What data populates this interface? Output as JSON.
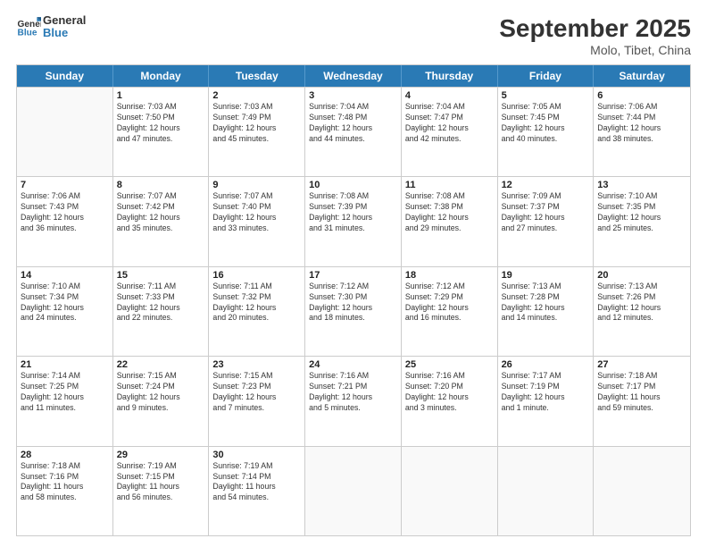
{
  "header": {
    "logo_line1": "General",
    "logo_line2": "Blue",
    "title": "September 2025",
    "subtitle": "Molo, Tibet, China"
  },
  "weekdays": [
    "Sunday",
    "Monday",
    "Tuesday",
    "Wednesday",
    "Thursday",
    "Friday",
    "Saturday"
  ],
  "weeks": [
    [
      {
        "day": "",
        "info": ""
      },
      {
        "day": "1",
        "info": "Sunrise: 7:03 AM\nSunset: 7:50 PM\nDaylight: 12 hours\nand 47 minutes."
      },
      {
        "day": "2",
        "info": "Sunrise: 7:03 AM\nSunset: 7:49 PM\nDaylight: 12 hours\nand 45 minutes."
      },
      {
        "day": "3",
        "info": "Sunrise: 7:04 AM\nSunset: 7:48 PM\nDaylight: 12 hours\nand 44 minutes."
      },
      {
        "day": "4",
        "info": "Sunrise: 7:04 AM\nSunset: 7:47 PM\nDaylight: 12 hours\nand 42 minutes."
      },
      {
        "day": "5",
        "info": "Sunrise: 7:05 AM\nSunset: 7:45 PM\nDaylight: 12 hours\nand 40 minutes."
      },
      {
        "day": "6",
        "info": "Sunrise: 7:06 AM\nSunset: 7:44 PM\nDaylight: 12 hours\nand 38 minutes."
      }
    ],
    [
      {
        "day": "7",
        "info": "Sunrise: 7:06 AM\nSunset: 7:43 PM\nDaylight: 12 hours\nand 36 minutes."
      },
      {
        "day": "8",
        "info": "Sunrise: 7:07 AM\nSunset: 7:42 PM\nDaylight: 12 hours\nand 35 minutes."
      },
      {
        "day": "9",
        "info": "Sunrise: 7:07 AM\nSunset: 7:40 PM\nDaylight: 12 hours\nand 33 minutes."
      },
      {
        "day": "10",
        "info": "Sunrise: 7:08 AM\nSunset: 7:39 PM\nDaylight: 12 hours\nand 31 minutes."
      },
      {
        "day": "11",
        "info": "Sunrise: 7:08 AM\nSunset: 7:38 PM\nDaylight: 12 hours\nand 29 minutes."
      },
      {
        "day": "12",
        "info": "Sunrise: 7:09 AM\nSunset: 7:37 PM\nDaylight: 12 hours\nand 27 minutes."
      },
      {
        "day": "13",
        "info": "Sunrise: 7:10 AM\nSunset: 7:35 PM\nDaylight: 12 hours\nand 25 minutes."
      }
    ],
    [
      {
        "day": "14",
        "info": "Sunrise: 7:10 AM\nSunset: 7:34 PM\nDaylight: 12 hours\nand 24 minutes."
      },
      {
        "day": "15",
        "info": "Sunrise: 7:11 AM\nSunset: 7:33 PM\nDaylight: 12 hours\nand 22 minutes."
      },
      {
        "day": "16",
        "info": "Sunrise: 7:11 AM\nSunset: 7:32 PM\nDaylight: 12 hours\nand 20 minutes."
      },
      {
        "day": "17",
        "info": "Sunrise: 7:12 AM\nSunset: 7:30 PM\nDaylight: 12 hours\nand 18 minutes."
      },
      {
        "day": "18",
        "info": "Sunrise: 7:12 AM\nSunset: 7:29 PM\nDaylight: 12 hours\nand 16 minutes."
      },
      {
        "day": "19",
        "info": "Sunrise: 7:13 AM\nSunset: 7:28 PM\nDaylight: 12 hours\nand 14 minutes."
      },
      {
        "day": "20",
        "info": "Sunrise: 7:13 AM\nSunset: 7:26 PM\nDaylight: 12 hours\nand 12 minutes."
      }
    ],
    [
      {
        "day": "21",
        "info": "Sunrise: 7:14 AM\nSunset: 7:25 PM\nDaylight: 12 hours\nand 11 minutes."
      },
      {
        "day": "22",
        "info": "Sunrise: 7:15 AM\nSunset: 7:24 PM\nDaylight: 12 hours\nand 9 minutes."
      },
      {
        "day": "23",
        "info": "Sunrise: 7:15 AM\nSunset: 7:23 PM\nDaylight: 12 hours\nand 7 minutes."
      },
      {
        "day": "24",
        "info": "Sunrise: 7:16 AM\nSunset: 7:21 PM\nDaylight: 12 hours\nand 5 minutes."
      },
      {
        "day": "25",
        "info": "Sunrise: 7:16 AM\nSunset: 7:20 PM\nDaylight: 12 hours\nand 3 minutes."
      },
      {
        "day": "26",
        "info": "Sunrise: 7:17 AM\nSunset: 7:19 PM\nDaylight: 12 hours\nand 1 minute."
      },
      {
        "day": "27",
        "info": "Sunrise: 7:18 AM\nSunset: 7:17 PM\nDaylight: 11 hours\nand 59 minutes."
      }
    ],
    [
      {
        "day": "28",
        "info": "Sunrise: 7:18 AM\nSunset: 7:16 PM\nDaylight: 11 hours\nand 58 minutes."
      },
      {
        "day": "29",
        "info": "Sunrise: 7:19 AM\nSunset: 7:15 PM\nDaylight: 11 hours\nand 56 minutes."
      },
      {
        "day": "30",
        "info": "Sunrise: 7:19 AM\nSunset: 7:14 PM\nDaylight: 11 hours\nand 54 minutes."
      },
      {
        "day": "",
        "info": ""
      },
      {
        "day": "",
        "info": ""
      },
      {
        "day": "",
        "info": ""
      },
      {
        "day": "",
        "info": ""
      }
    ]
  ]
}
